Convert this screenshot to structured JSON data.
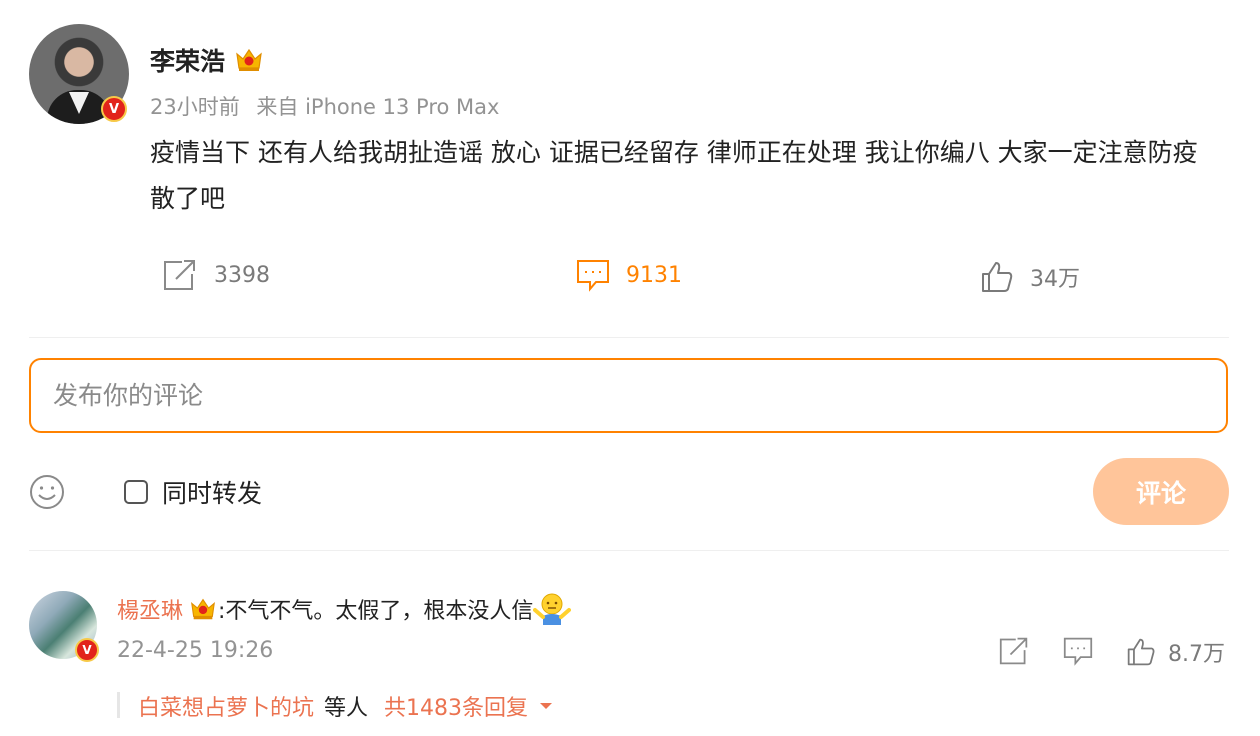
{
  "post": {
    "author": "李荣浩",
    "time": "23小时前",
    "source": "来自 iPhone 13 Pro Max",
    "text": "疫情当下 还有人给我胡扯造谣 放心 证据已经留存 律师正在处理 我让你编八 大家一定注意防疫 散了吧",
    "verified_mark": "V",
    "actions": {
      "repost_count": "3398",
      "comment_count": "9131",
      "like_count": "34万"
    }
  },
  "composer": {
    "placeholder": "发布你的评论",
    "forward_label": "同时转发",
    "submit_label": "评论"
  },
  "comment": {
    "author": "楊丞琳",
    "text": ":不气不气。太假了，根本没人信",
    "time": "22-4-25 19:26",
    "like_count": "8.7万",
    "verified_mark": "V",
    "replies": {
      "first_user": "白菜想占萝卜的坑",
      "etc": "等人",
      "total": "共1483条回复"
    }
  },
  "colors": {
    "accent": "#ff8200",
    "name_orange": "#eb7350",
    "submit_disabled": "#ffc59a",
    "meta_gray": "#939393"
  },
  "icons": [
    "crown-icon",
    "repost-icon",
    "comment-icon",
    "like-icon",
    "emoji-icon",
    "shrug-emoji-icon",
    "caret-down-icon"
  ]
}
